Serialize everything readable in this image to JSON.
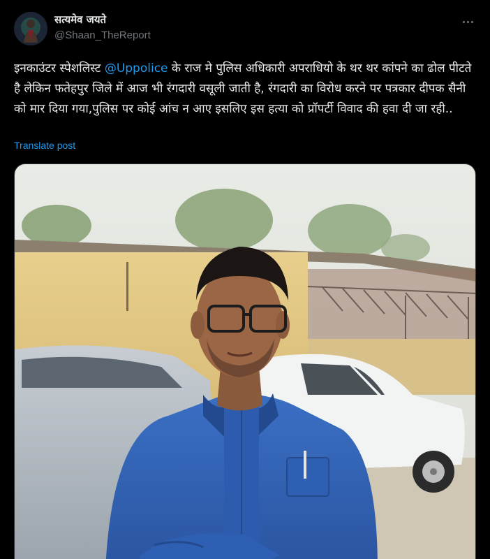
{
  "author": {
    "display_name": "सत्यमेव जयते",
    "handle": "@Shaan_TheReport"
  },
  "tweet": {
    "text_before": "इनकाउंटर स्पेशलिस्ट ",
    "mention": "@Uppolice",
    "text_after": " के राज मे पुलिस अधिकारी अपराधियो के थर थर कांपने का ढोल पीटते है लेकिन फतेहपुर जिले में आज भी रंगदारी वसूली जाती है, रंगदारी का विरोध करने पर पत्रकार दीपक सैनी को मार दिया गया,पुलिस पर कोई आंच न आए इसलिए इस हत्या को प्रॉपर्टी विवाद की हवा दी जा रही..",
    "translate_label": "Translate post"
  },
  "icons": {
    "more": "more-dots-icon"
  },
  "colors": {
    "background": "#000000",
    "text": "#e7e9ea",
    "secondary": "#71767b",
    "accent": "#1d9bf0"
  }
}
